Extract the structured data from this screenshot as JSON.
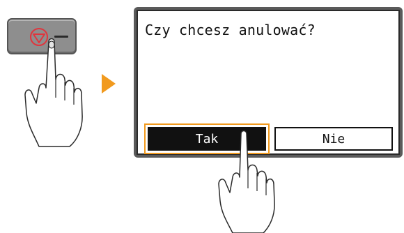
{
  "device": {
    "stop_key": {
      "icon": "stop-icon",
      "icon_color": "#e0353d",
      "dash": "—"
    }
  },
  "arrow": {
    "icon": "play-arrow-icon",
    "color": "#f19a1e"
  },
  "screen": {
    "prompt": "Czy chcesz anulować?",
    "buttons": {
      "yes_label": "Tak",
      "no_label": "Nie"
    },
    "highlight_color": "#f19a1e"
  }
}
